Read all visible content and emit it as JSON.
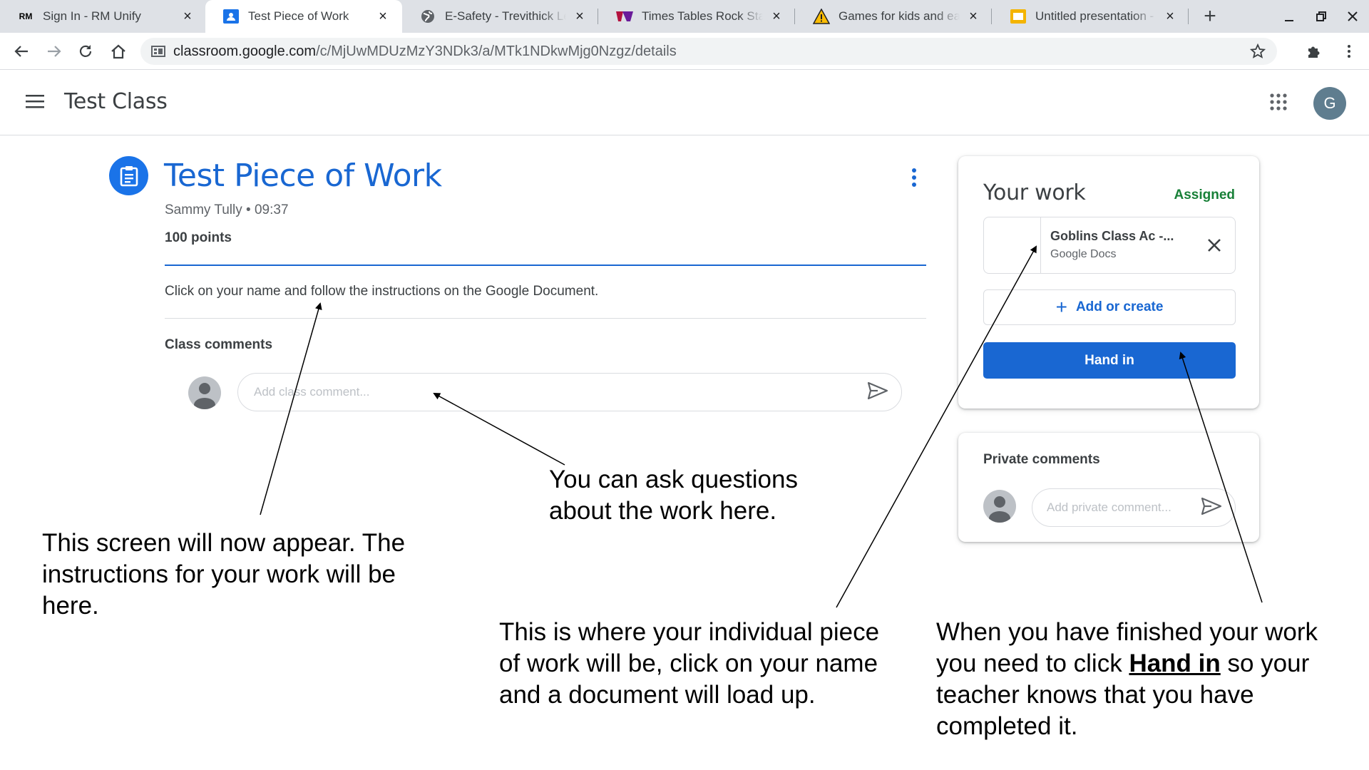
{
  "browser": {
    "tabs": [
      {
        "label": "Sign In - RM Unify",
        "favicon": "RM"
      },
      {
        "label": "Test Piece of Work",
        "favicon": "classroom-icon"
      },
      {
        "label": "E-Safety - Trevithick Lear",
        "favicon": "globe-icon"
      },
      {
        "label": "Times Tables Rock Stars",
        "favicon": "ttrs-icon"
      },
      {
        "label": "Games for kids and early",
        "favicon": "warning-icon"
      },
      {
        "label": "Untitled presentation - G",
        "favicon": "slides-icon"
      }
    ],
    "active_tab": 1,
    "url_host": "classroom.google.com",
    "url_path": "/c/MjUwMDUzMzY3NDk3/a/MTk1NDkwMjg0Nzgz/details"
  },
  "header": {
    "class_title": "Test Class",
    "avatar_letter": "G"
  },
  "assignment": {
    "title": "Test Piece of Work",
    "author": "Sammy Tully",
    "separator": " • ",
    "time": "09:37",
    "points": "100 points",
    "instructions": "Click on your name and follow the instructions on the Google Document.",
    "class_comments_label": "Class comments",
    "class_comment_placeholder": "Add class comment..."
  },
  "your_work": {
    "title": "Your work",
    "status": "Assigned",
    "attachment_name": "Goblins Class Ac -...",
    "attachment_type": "Google Docs",
    "add_or_create_label": "Add or create",
    "hand_in_label": "Hand in"
  },
  "private_comments": {
    "label": "Private comments",
    "placeholder": "Add private comment..."
  },
  "annotations": {
    "instructions_note": "This screen will now appear. The instructions for your work will be here.",
    "questions_note": "You can ask questions about the work here.",
    "work_note": "This is where your individual piece of work will be, click on your name and a document will load up.",
    "hand_in_note_before": "When you have finished your work you need to click ",
    "hand_in_note_bold": "Hand in",
    "hand_in_note_after": " so your teacher knows that you have completed it."
  },
  "colors": {
    "accent_blue": "#1967d2",
    "assigned_green": "#188038"
  }
}
